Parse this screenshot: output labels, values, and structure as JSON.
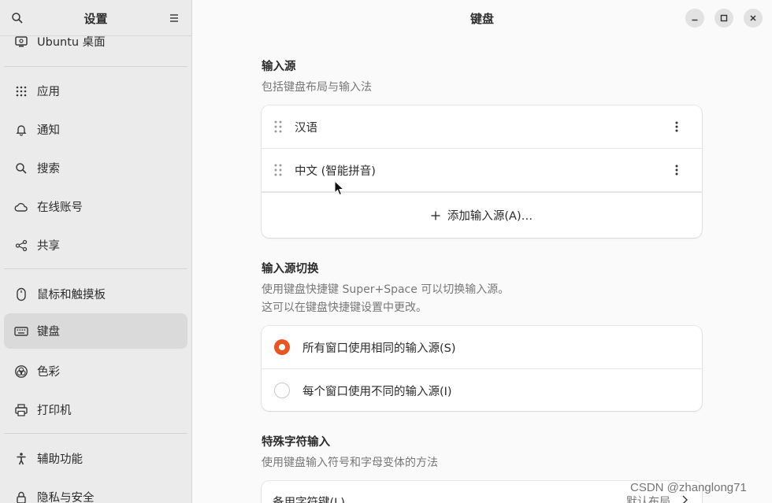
{
  "sidebar": {
    "title": "设置",
    "items": [
      {
        "label": "Ubuntu 桌面",
        "icon": "ubuntu-desktop-icon"
      },
      {
        "label": "应用",
        "icon": "apps-grid-icon"
      },
      {
        "label": "通知",
        "icon": "bell-icon"
      },
      {
        "label": "搜索",
        "icon": "search-icon"
      },
      {
        "label": "在线账号",
        "icon": "cloud-icon"
      },
      {
        "label": "共享",
        "icon": "share-icon"
      },
      {
        "label": "鼠标和触摸板",
        "icon": "mouse-icon"
      },
      {
        "label": "键盘",
        "icon": "keyboard-icon"
      },
      {
        "label": "色彩",
        "icon": "color-icon"
      },
      {
        "label": "打印机",
        "icon": "printer-icon"
      },
      {
        "label": "辅助功能",
        "icon": "accessibility-icon"
      },
      {
        "label": "隐私与安全",
        "icon": "privacy-icon"
      }
    ],
    "active_index": 7
  },
  "header": {
    "title": "键盘"
  },
  "input_sources": {
    "title": "输入源",
    "description": "包括键盘布局与输入法",
    "items": [
      "汉语",
      "中文 (智能拼音)"
    ],
    "add_label": "添加输入源(A)…"
  },
  "switching": {
    "title": "输入源切换",
    "description_line1": "使用键盘快捷键 Super+Space 可以切换输入源。",
    "description_line2": "这可以在键盘快捷键设置中更改。",
    "options": [
      {
        "label": "所有窗口使用相同的输入源(S)",
        "selected": true
      },
      {
        "label": "每个窗口使用不同的输入源(I)",
        "selected": false
      }
    ]
  },
  "special_chars": {
    "title": "特殊字符输入",
    "description": "使用键盘输入符号和字母变体的方法",
    "first_row_label": "备用字符键(L)",
    "first_row_value": "默认布局"
  },
  "watermark": "CSDN @zhanglong71",
  "colors": {
    "accent": "#e95420",
    "sidebar_bg": "#ebebeb",
    "active_item_bg": "#dadada"
  }
}
